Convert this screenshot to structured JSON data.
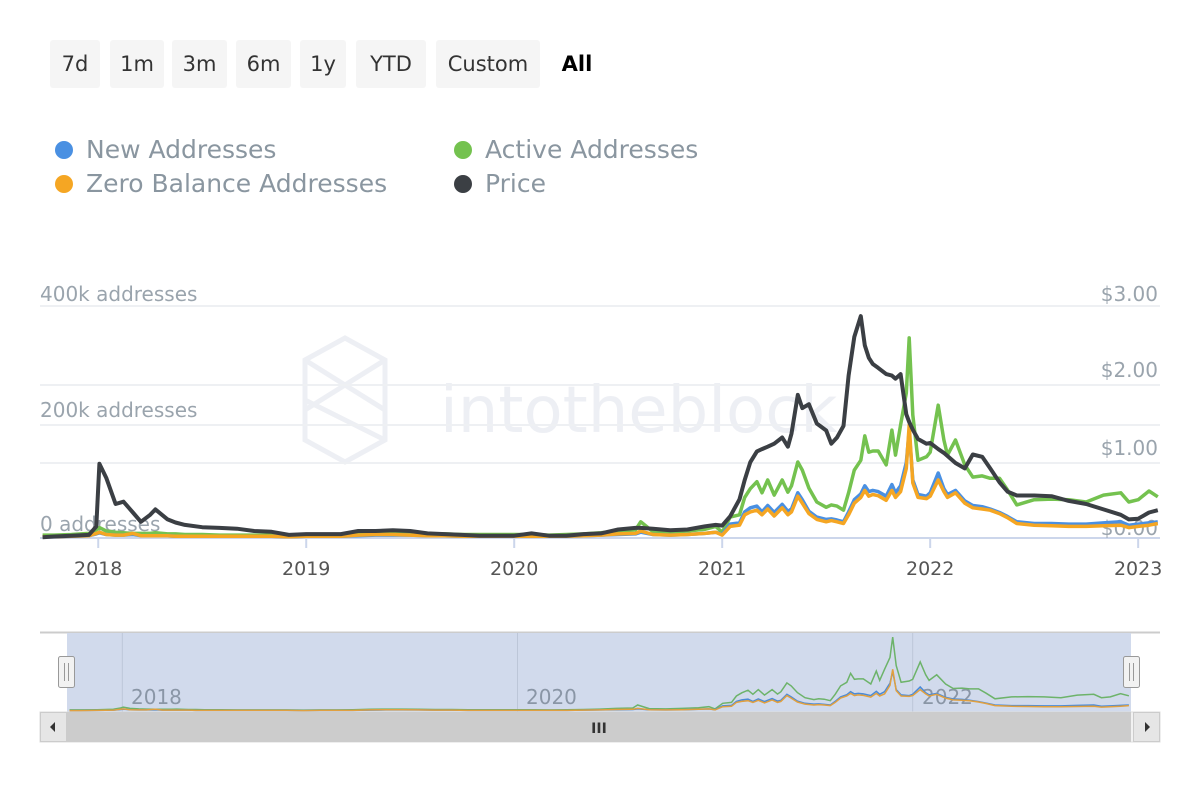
{
  "range_selector": {
    "buttons": [
      "7d",
      "1m",
      "3m",
      "6m",
      "1y",
      "YTD",
      "Custom",
      "All"
    ],
    "selected": "All"
  },
  "legend": [
    {
      "label": "New Addresses",
      "color": "#4a90e2"
    },
    {
      "label": "Active Addresses",
      "color": "#74c24f"
    },
    {
      "label": "Zero Balance Addresses",
      "color": "#f5a623"
    },
    {
      "label": "Price",
      "color": "#3b3f44"
    }
  ],
  "watermark": "intotheblock",
  "navigator": {
    "labels": [
      "2018",
      "2020",
      "2022"
    ],
    "grip": "III"
  },
  "chart_data": {
    "type": "line",
    "x_ticks": [
      "2018",
      "2019",
      "2020",
      "2021",
      "2022",
      "2023"
    ],
    "y_left": {
      "ticks": [
        "0 addresses",
        "200k addresses",
        "400k addresses"
      ],
      "range": [
        0,
        400000
      ]
    },
    "y_right": {
      "ticks": [
        "$0.00",
        "$1.00",
        "$2.00",
        "$3.00"
      ],
      "range": [
        0,
        3
      ]
    },
    "grid": true,
    "legend_position": "top",
    "dates": [
      "2017-09-25",
      "2017-10-15",
      "2017-11-15",
      "2017-12-15",
      "2017-12-28",
      "2018-01-03",
      "2018-01-15",
      "2018-02-01",
      "2018-02-15",
      "2018-03-01",
      "2018-03-15",
      "2018-04-01",
      "2018-04-10",
      "2018-05-01",
      "2018-05-15",
      "2018-06-01",
      "2018-07-01",
      "2018-08-01",
      "2018-09-01",
      "2018-10-01",
      "2018-11-01",
      "2018-12-01",
      "2019-01-01",
      "2019-02-01",
      "2019-03-01",
      "2019-04-01",
      "2019-05-01",
      "2019-06-01",
      "2019-07-01",
      "2019-08-01",
      "2019-09-01",
      "2019-10-01",
      "2019-11-01",
      "2019-12-01",
      "2020-01-01",
      "2020-02-01",
      "2020-03-01",
      "2020-04-01",
      "2020-05-01",
      "2020-06-01",
      "2020-07-01",
      "2020-08-01",
      "2020-08-10",
      "2020-09-01",
      "2020-10-01",
      "2020-11-01",
      "2020-12-01",
      "2020-12-20",
      "2021-01-01",
      "2021-01-15",
      "2021-02-01",
      "2021-02-10",
      "2021-02-20",
      "2021-03-01",
      "2021-03-10",
      "2021-03-20",
      "2021-04-01",
      "2021-04-15",
      "2021-04-25",
      "2021-05-01",
      "2021-05-12",
      "2021-05-20",
      "2021-06-01",
      "2021-06-15",
      "2021-07-01",
      "2021-07-10",
      "2021-07-20",
      "2021-08-01",
      "2021-08-10",
      "2021-08-20",
      "2021-09-01",
      "2021-09-08",
      "2021-09-15",
      "2021-09-22",
      "2021-10-01",
      "2021-10-15",
      "2021-10-25",
      "2021-11-01",
      "2021-11-10",
      "2021-11-20",
      "2021-11-25",
      "2021-12-01",
      "2021-12-10",
      "2021-12-25",
      "2022-01-01",
      "2022-01-15",
      "2022-01-25",
      "2022-02-01",
      "2022-02-15",
      "2022-03-01",
      "2022-03-15",
      "2022-04-01",
      "2022-04-15",
      "2022-05-01",
      "2022-05-15",
      "2022-06-01",
      "2022-07-01",
      "2022-08-01",
      "2022-09-01",
      "2022-10-01",
      "2022-11-01",
      "2022-12-01",
      "2022-12-15",
      "2023-01-01",
      "2023-01-20",
      "2023-02-05"
    ],
    "series": [
      {
        "name": "Active Addresses",
        "axis": "left",
        "color": "#74c24f",
        "values_k": [
          5,
          5,
          6,
          8,
          14,
          18,
          12,
          10,
          9,
          8,
          8,
          8,
          9,
          7,
          7,
          6,
          6,
          5,
          5,
          5,
          5,
          4,
          5,
          5,
          6,
          8,
          9,
          9,
          8,
          7,
          7,
          6,
          6,
          6,
          6,
          6,
          5,
          6,
          7,
          9,
          12,
          14,
          28,
          11,
          10,
          12,
          15,
          20,
          10,
          36,
          40,
          70,
          85,
          97,
          78,
          100,
          74,
          100,
          79,
          90,
          131,
          117,
          86,
          62,
          53,
          57,
          55,
          48,
          78,
          117,
          134,
          176,
          148,
          150,
          150,
          126,
          186,
          143,
          195,
          250,
          345,
          212,
          134,
          140,
          148,
          229,
          169,
          143,
          169,
          126,
          105,
          107,
          103,
          103,
          83,
          57,
          66,
          67,
          66,
          62,
          74,
          78,
          62,
          66,
          81,
          71
        ]
      },
      {
        "name": "New Addresses",
        "axis": "left",
        "color": "#4a90e2",
        "values_k": [
          2,
          2,
          3,
          4,
          7,
          9,
          6,
          5,
          5,
          6,
          4,
          4,
          4,
          4,
          3,
          3,
          3,
          3,
          3,
          3,
          3,
          2,
          3,
          3,
          3,
          4,
          5,
          5,
          5,
          4,
          4,
          3,
          3,
          3,
          3,
          3,
          3,
          3,
          4,
          5,
          6,
          7,
          10,
          6,
          5,
          6,
          8,
          10,
          6,
          24,
          26,
          45,
          52,
          55,
          45,
          56,
          44,
          58,
          46,
          50,
          78,
          66,
          46,
          36,
          32,
          33,
          31,
          28,
          45,
          66,
          76,
          90,
          80,
          82,
          80,
          72,
          92,
          78,
          90,
          130,
          185,
          100,
          75,
          72,
          78,
          112,
          85,
          75,
          82,
          64,
          56,
          54,
          50,
          44,
          37,
          28,
          25,
          25,
          24,
          24,
          26,
          28,
          22,
          24,
          26,
          28
        ]
      },
      {
        "name": "Zero Balance Addresses",
        "axis": "left",
        "color": "#f5a623",
        "values_k": [
          2,
          2,
          3,
          4,
          8,
          10,
          6,
          5,
          5,
          8,
          4,
          4,
          4,
          4,
          3,
          3,
          3,
          3,
          3,
          3,
          3,
          2,
          3,
          3,
          3,
          5,
          6,
          6,
          5,
          4,
          4,
          3,
          3,
          3,
          3,
          3,
          3,
          3,
          4,
          5,
          7,
          8,
          12,
          6,
          5,
          6,
          8,
          10,
          5,
          20,
          22,
          40,
          45,
          48,
          40,
          50,
          38,
          52,
          40,
          45,
          72,
          60,
          42,
          32,
          28,
          30,
          28,
          25,
          40,
          60,
          70,
          82,
          72,
          75,
          73,
          65,
          82,
          70,
          80,
          120,
          195,
          95,
          70,
          68,
          72,
          100,
          80,
          70,
          78,
          60,
          52,
          50,
          48,
          42,
          35,
          25,
          22,
          21,
          20,
          20,
          21,
          22,
          18,
          20,
          22,
          25
        ]
      },
      {
        "name": "Price",
        "axis": "right",
        "color": "#3b3f44",
        "values_usd": [
          0.01,
          0.02,
          0.03,
          0.04,
          0.15,
          0.96,
          0.78,
          0.44,
          0.47,
          0.33,
          0.21,
          0.3,
          0.37,
          0.24,
          0.2,
          0.17,
          0.14,
          0.13,
          0.12,
          0.09,
          0.08,
          0.04,
          0.05,
          0.05,
          0.05,
          0.09,
          0.09,
          0.1,
          0.09,
          0.06,
          0.05,
          0.04,
          0.03,
          0.03,
          0.03,
          0.06,
          0.03,
          0.03,
          0.05,
          0.06,
          0.11,
          0.13,
          0.13,
          0.12,
          0.1,
          0.11,
          0.15,
          0.17,
          0.16,
          0.28,
          0.5,
          0.75,
          0.98,
          1.12,
          1.15,
          1.18,
          1.22,
          1.3,
          1.18,
          1.35,
          1.85,
          1.68,
          1.73,
          1.48,
          1.39,
          1.22,
          1.3,
          1.45,
          2.1,
          2.6,
          2.87,
          2.49,
          2.33,
          2.25,
          2.2,
          2.12,
          2.1,
          2.06,
          2.12,
          1.6,
          1.5,
          1.4,
          1.28,
          1.22,
          1.23,
          1.15,
          1.1,
          1.06,
          0.97,
          0.9,
          1.08,
          1.05,
          0.9,
          0.72,
          0.6,
          0.55,
          0.55,
          0.54,
          0.48,
          0.44,
          0.37,
          0.3,
          0.24,
          0.25,
          0.33,
          0.36
        ]
      }
    ]
  }
}
